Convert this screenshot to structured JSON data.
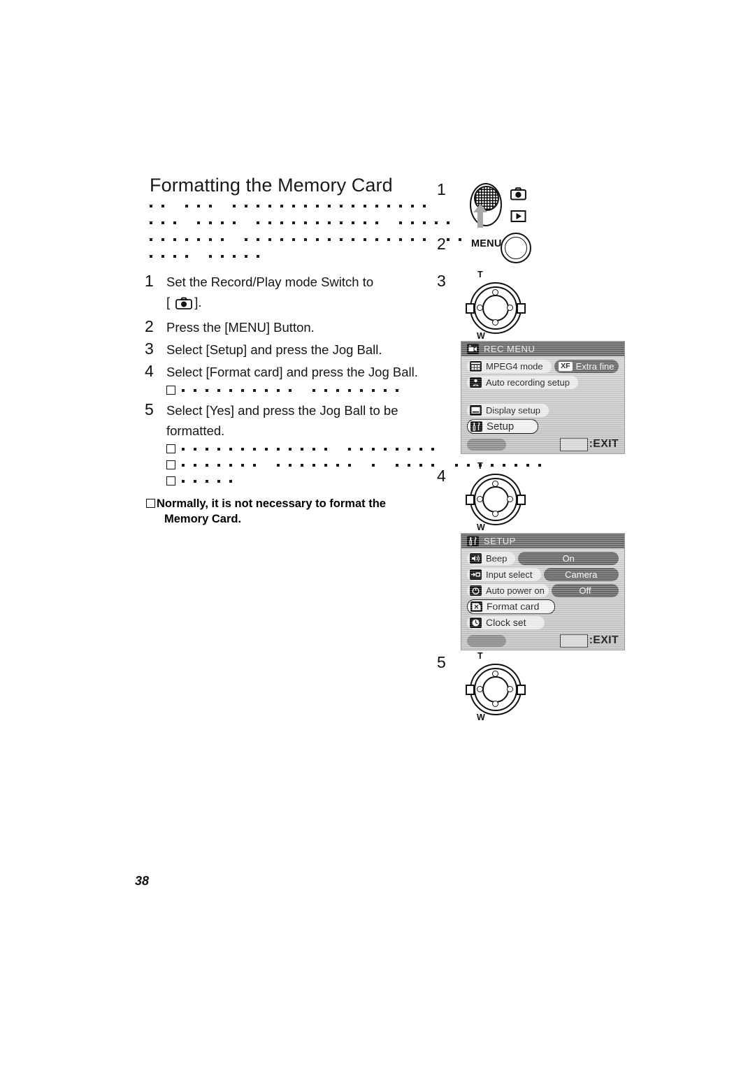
{
  "document": {
    "title": "Formatting the Memory Card",
    "page_number": "38"
  },
  "redacted_header": {
    "note": "Body paragraph rendered as redaction dots",
    "lines": [
      [
        2,
        3,
        17
      ],
      [
        3,
        4,
        11,
        5
      ],
      [
        7,
        16,
        2
      ],
      [
        4,
        5
      ]
    ]
  },
  "steps": [
    {
      "num": "1",
      "text_before_icon": "Set the Record/Play mode Switch to",
      "bracket_open": "[",
      "icon": "camera-record-icon",
      "bracket_close": "].",
      "redacted": []
    },
    {
      "num": "2",
      "text": "Press the [MENU] Button.",
      "redacted": []
    },
    {
      "num": "3",
      "text": "Select [Setup] and press the Jog Ball.",
      "redacted": []
    },
    {
      "num": "4",
      "text": "Select [Format card] and press the Jog Ball.",
      "redacted": [
        [
          10,
          8
        ]
      ]
    },
    {
      "num": "5",
      "text": "Select [Yes] and press the Jog Ball to be formatted.",
      "redacted": [
        [
          13,
          8
        ],
        [
          7,
          7,
          1,
          4,
          8
        ],
        [
          5
        ]
      ]
    }
  ],
  "note": {
    "bullet": "square-bullet-icon",
    "line1": "Normally, it is not necessary to format the",
    "line2": "Memory Card."
  },
  "callouts": [
    {
      "id": "1",
      "label": "1"
    },
    {
      "id": "2",
      "label": "2"
    },
    {
      "id": "3",
      "label": "3"
    },
    {
      "id": "4",
      "label": "4"
    },
    {
      "id": "5",
      "label": "5"
    }
  ],
  "controls": {
    "mode_switch": {
      "name": "record-play-mode-switch",
      "record_icon": "camera-record-icon",
      "play_icon": "play-icon"
    },
    "menu_button": {
      "label": "MENU",
      "name": "menu-button"
    },
    "jog_ball": {
      "top_label": "T",
      "bottom_label": "W"
    }
  },
  "screens": {
    "rec_menu": {
      "title": "REC MENU",
      "title_icon": "camcorder-icon",
      "rows": [
        {
          "icon": "grid-icon",
          "label": "MPEG4 mode",
          "value": "Extra fine",
          "badge": "XF",
          "selected": false,
          "has_value": true
        },
        {
          "icon": "person-a-icon",
          "label": "Auto recording setup",
          "value": "",
          "badge": "",
          "selected": false,
          "has_value": false
        }
      ],
      "rows2": [
        {
          "icon": "display-icon",
          "label": "Display setup",
          "value": "",
          "selected": false,
          "has_value": false
        },
        {
          "icon": "tools-icon",
          "label": "Setup",
          "value": "",
          "selected": true,
          "has_value": false
        }
      ],
      "exit_label": ":EXIT"
    },
    "setup": {
      "title": "SETUP",
      "title_icon": "tools-icon",
      "rows": [
        {
          "icon": "speaker-icon",
          "label": "Beep",
          "value": "On",
          "selected": false,
          "has_value": true
        },
        {
          "icon": "input-icon",
          "label": "Input select",
          "value": "Camera",
          "selected": false,
          "has_value": true
        },
        {
          "icon": "power-icon",
          "label": "Auto power on",
          "value": "Off",
          "selected": false,
          "has_value": true
        },
        {
          "icon": "format-card-icon",
          "label": "Format card",
          "value": "",
          "selected": true,
          "has_value": false
        },
        {
          "icon": "clock-icon",
          "label": "Clock set",
          "value": "",
          "selected": false,
          "has_value": false
        }
      ],
      "exit_label": ":EXIT"
    }
  },
  "colors": {
    "lcd_header": "#6d6d6d",
    "lcd_value_pill": "#6a6a6a",
    "lcd_label_pill": "#efefef",
    "ink": "#111111"
  }
}
